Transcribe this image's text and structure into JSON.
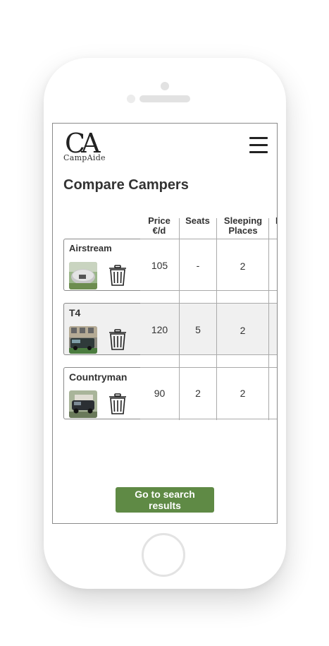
{
  "app": {
    "logo_mark": "CA",
    "logo_text": "CampAide"
  },
  "page": {
    "title": "Compare Campers"
  },
  "table": {
    "columns": [
      {
        "label_line1": "Price",
        "label_line2": "€/d"
      },
      {
        "label_line1": "Seats",
        "label_line2": ""
      },
      {
        "label_line1": "Sleeping",
        "label_line2": "Places"
      }
    ],
    "rows": [
      {
        "name": "Airstream",
        "price": "105",
        "seats": "-",
        "sleeping": "2"
      },
      {
        "name": "T4",
        "price": "120",
        "seats": "5",
        "sleeping": "2"
      },
      {
        "name": "Countryman",
        "price": "90",
        "seats": "2",
        "sleeping": "2"
      }
    ]
  },
  "footer": {
    "cta_label": "Go to search results"
  },
  "colors": {
    "accent": "#5f8a45",
    "row_shade": "#f0f0f0",
    "text": "#333333"
  },
  "icons": {
    "menu": "hamburger-menu-icon",
    "delete": "trash-icon"
  }
}
